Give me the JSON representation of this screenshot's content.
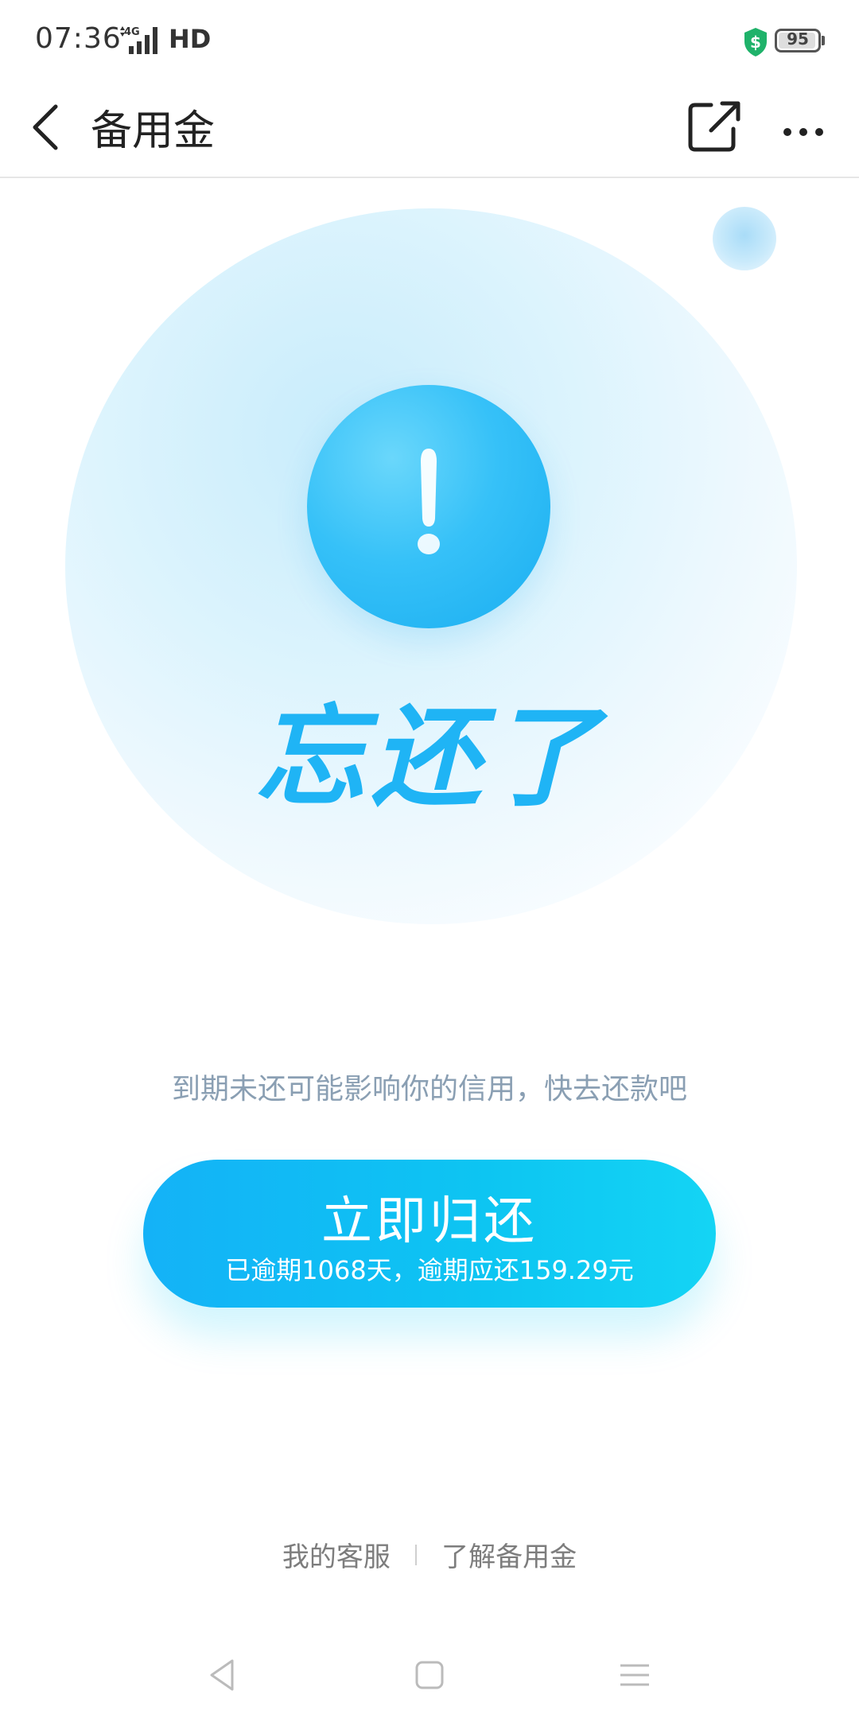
{
  "status_bar": {
    "time": "07:36",
    "network": "4G",
    "hd": "HD",
    "battery": "95",
    "battery_level": 0.95
  },
  "header": {
    "title": "备用金",
    "back_icon": "chevron-left-icon",
    "share_icon": "share-external-icon",
    "more_icon": "more-dots-icon"
  },
  "hero": {
    "title": "忘还了",
    "icon": "exclamation-icon"
  },
  "subtitle": "到期未还可能影响你的信用，快去还款吧",
  "repay_button": {
    "label": "立即归还",
    "detail": "已逾期1068天，逾期应还159.29元"
  },
  "footer": {
    "links": [
      "我的客服",
      "了解备用金"
    ]
  },
  "colors": {
    "accent": "#1fb4f5",
    "button_start": "#14b2f7",
    "button_end": "#14d4f4",
    "subtitle": "#8a9fb3"
  }
}
